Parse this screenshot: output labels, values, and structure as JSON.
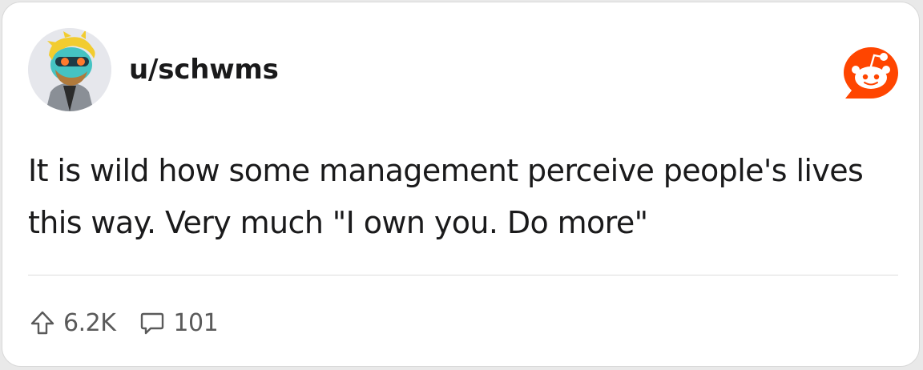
{
  "post": {
    "username": "u/schwms",
    "text": "It is wild how some management perceive people's lives this way. Very much \"I own you. Do more\"",
    "upvotes": "6.2K",
    "comments": "101"
  },
  "icons": {
    "avatar": "user-avatar-snoo",
    "logo": "reddit-logo-icon",
    "upvote": "upvote-arrow-icon",
    "comment": "comment-bubble-icon"
  },
  "colors": {
    "brand": "#ff4500",
    "text": "#1a1a1b",
    "muted": "#5a5a5a",
    "divider": "#dddddd"
  }
}
